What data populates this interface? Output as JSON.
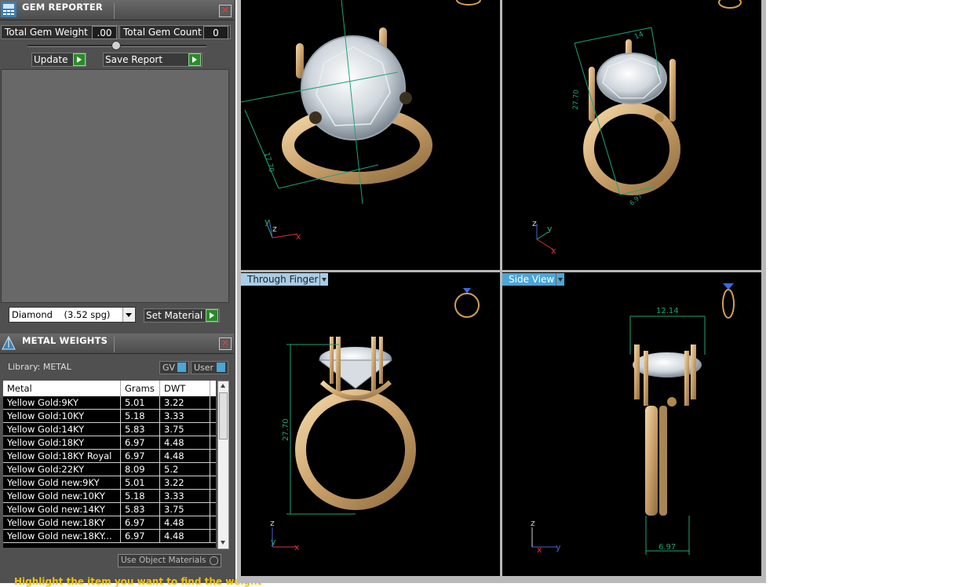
{
  "gem_reporter": {
    "title": "GEM REPORTER",
    "total_weight_label": "Total Gem Weight",
    "total_weight_value": ".00",
    "total_count_label": "Total Gem Count",
    "total_count_value": "0",
    "update_label": "Update",
    "save_report_label": "Save Report",
    "material_value": "Diamond    (3.52 spg)",
    "set_material_label": "Set Material"
  },
  "metal_weights": {
    "title": "METAL WEIGHTS",
    "library_label": "Library: METAL",
    "gv_label": "GV",
    "user_label": "User",
    "columns": [
      "Metal",
      "Grams",
      "DWT"
    ],
    "rows": [
      [
        "Yellow Gold:9KY",
        "5.01",
        "3.22"
      ],
      [
        "Yellow Gold:10KY",
        "5.18",
        "3.33"
      ],
      [
        "Yellow Gold:14KY",
        "5.83",
        "3.75"
      ],
      [
        "Yellow Gold:18KY",
        "6.97",
        "4.48"
      ],
      [
        "Yellow Gold:18KY Royal",
        "6.97",
        "4.48"
      ],
      [
        "Yellow Gold:22KY",
        "8.09",
        "5.2"
      ],
      [
        "Yellow Gold new:9KY",
        "5.01",
        "3.22"
      ],
      [
        "Yellow Gold new:10KY",
        "5.18",
        "3.33"
      ],
      [
        "Yellow Gold new:14KY",
        "5.83",
        "3.75"
      ],
      [
        "Yellow Gold new:18KY",
        "6.97",
        "4.48"
      ],
      [
        "Yellow Gold new:18KY...",
        "6.97",
        "4.48"
      ]
    ],
    "use_object_materials_label": "Use Object Materials",
    "hint": "Highlight the item you want to find the weight"
  },
  "viewports": {
    "bottom_left_label": "Through Finger",
    "bottom_right_label": "Side View",
    "dims": {
      "persp_a": "17.70",
      "persp_b1": "14",
      "persp_b2": "27.70",
      "persp_b3": "6.97",
      "front_height": "27.70",
      "side_width_top": "12.14",
      "side_width_bottom": "6.97"
    },
    "axis": {
      "x": "x",
      "y": "y",
      "z": "z"
    }
  },
  "colors": {
    "dim_line": "#1fa37a",
    "gold": "#d4b07a",
    "label_bg": "#4aa6d6",
    "hint": "#f2c200"
  }
}
